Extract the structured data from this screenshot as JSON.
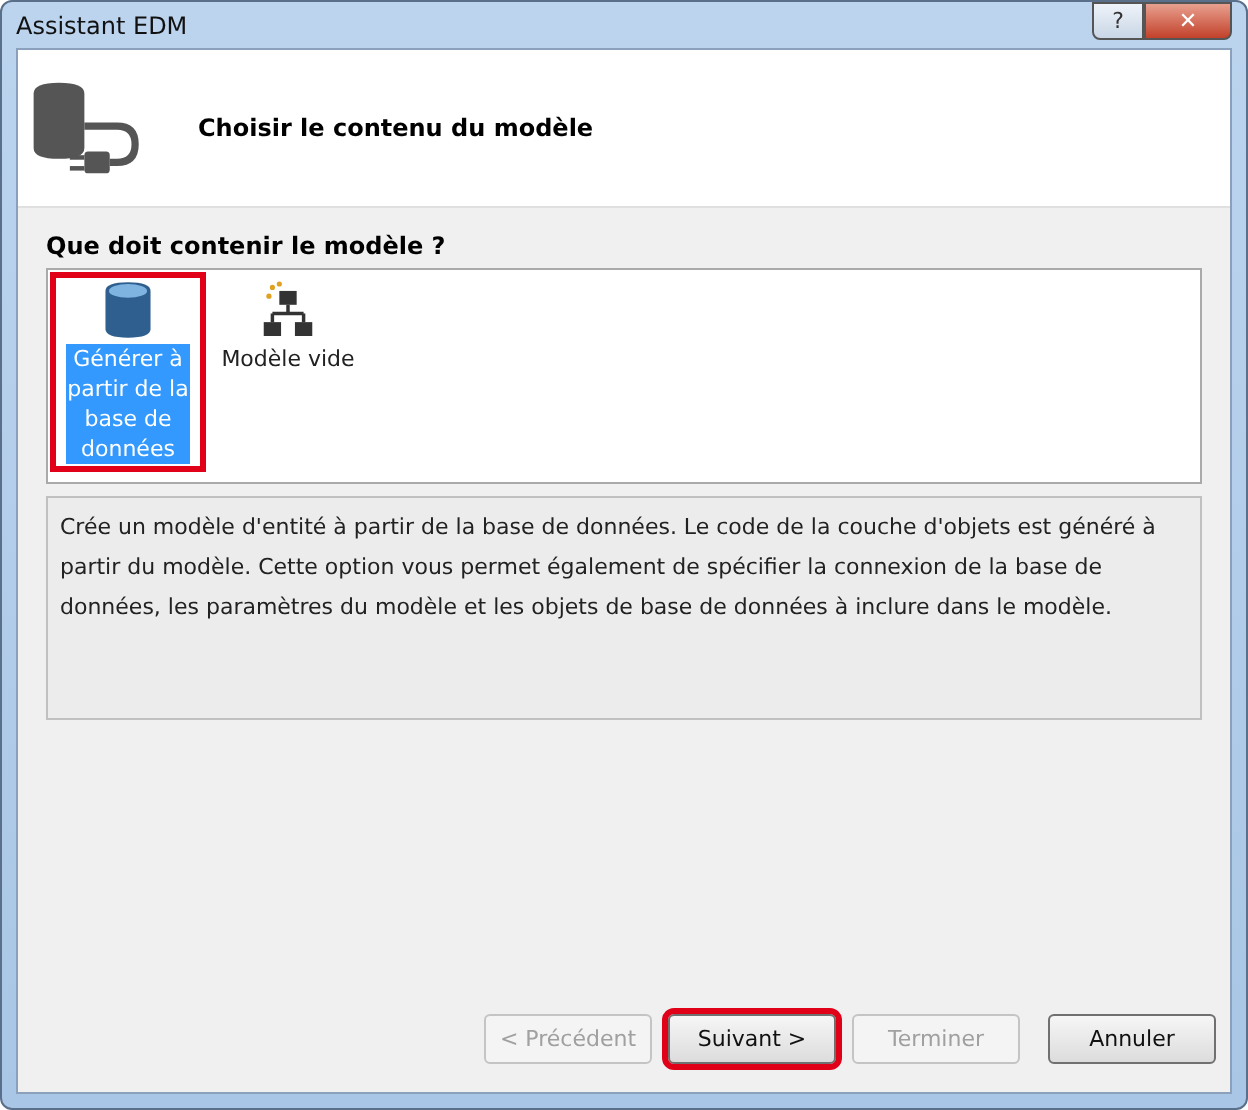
{
  "window": {
    "title": "Assistant EDM",
    "controls": [
      "?",
      "✕"
    ]
  },
  "header": {
    "title": "Choisir le contenu du modèle"
  },
  "prompt": "Que doit contenir le modèle ?",
  "options": [
    {
      "label": "Générer à partir de la base de données",
      "kind": "database",
      "selected": true,
      "highlighted": true
    },
    {
      "label": "Modèle vide",
      "kind": "hierarchy",
      "selected": false,
      "highlighted": false
    }
  ],
  "description": "Crée un modèle d'entité à partir de la base de données. Le code de la couche d'objets est généré à partir du modèle. Cette option vous permet également de spécifier la connexion de la base de données, les paramètres du modèle et les objets de base de données à inclure dans le modèle.",
  "buttons": [
    {
      "label": "< Précédent",
      "disabled": true,
      "highlighted": false
    },
    {
      "label": "Suivant >",
      "disabled": false,
      "highlighted": true
    },
    {
      "label": "Terminer",
      "disabled": true,
      "highlighted": false
    },
    {
      "label": "Annuler",
      "disabled": false,
      "highlighted": false
    }
  ]
}
